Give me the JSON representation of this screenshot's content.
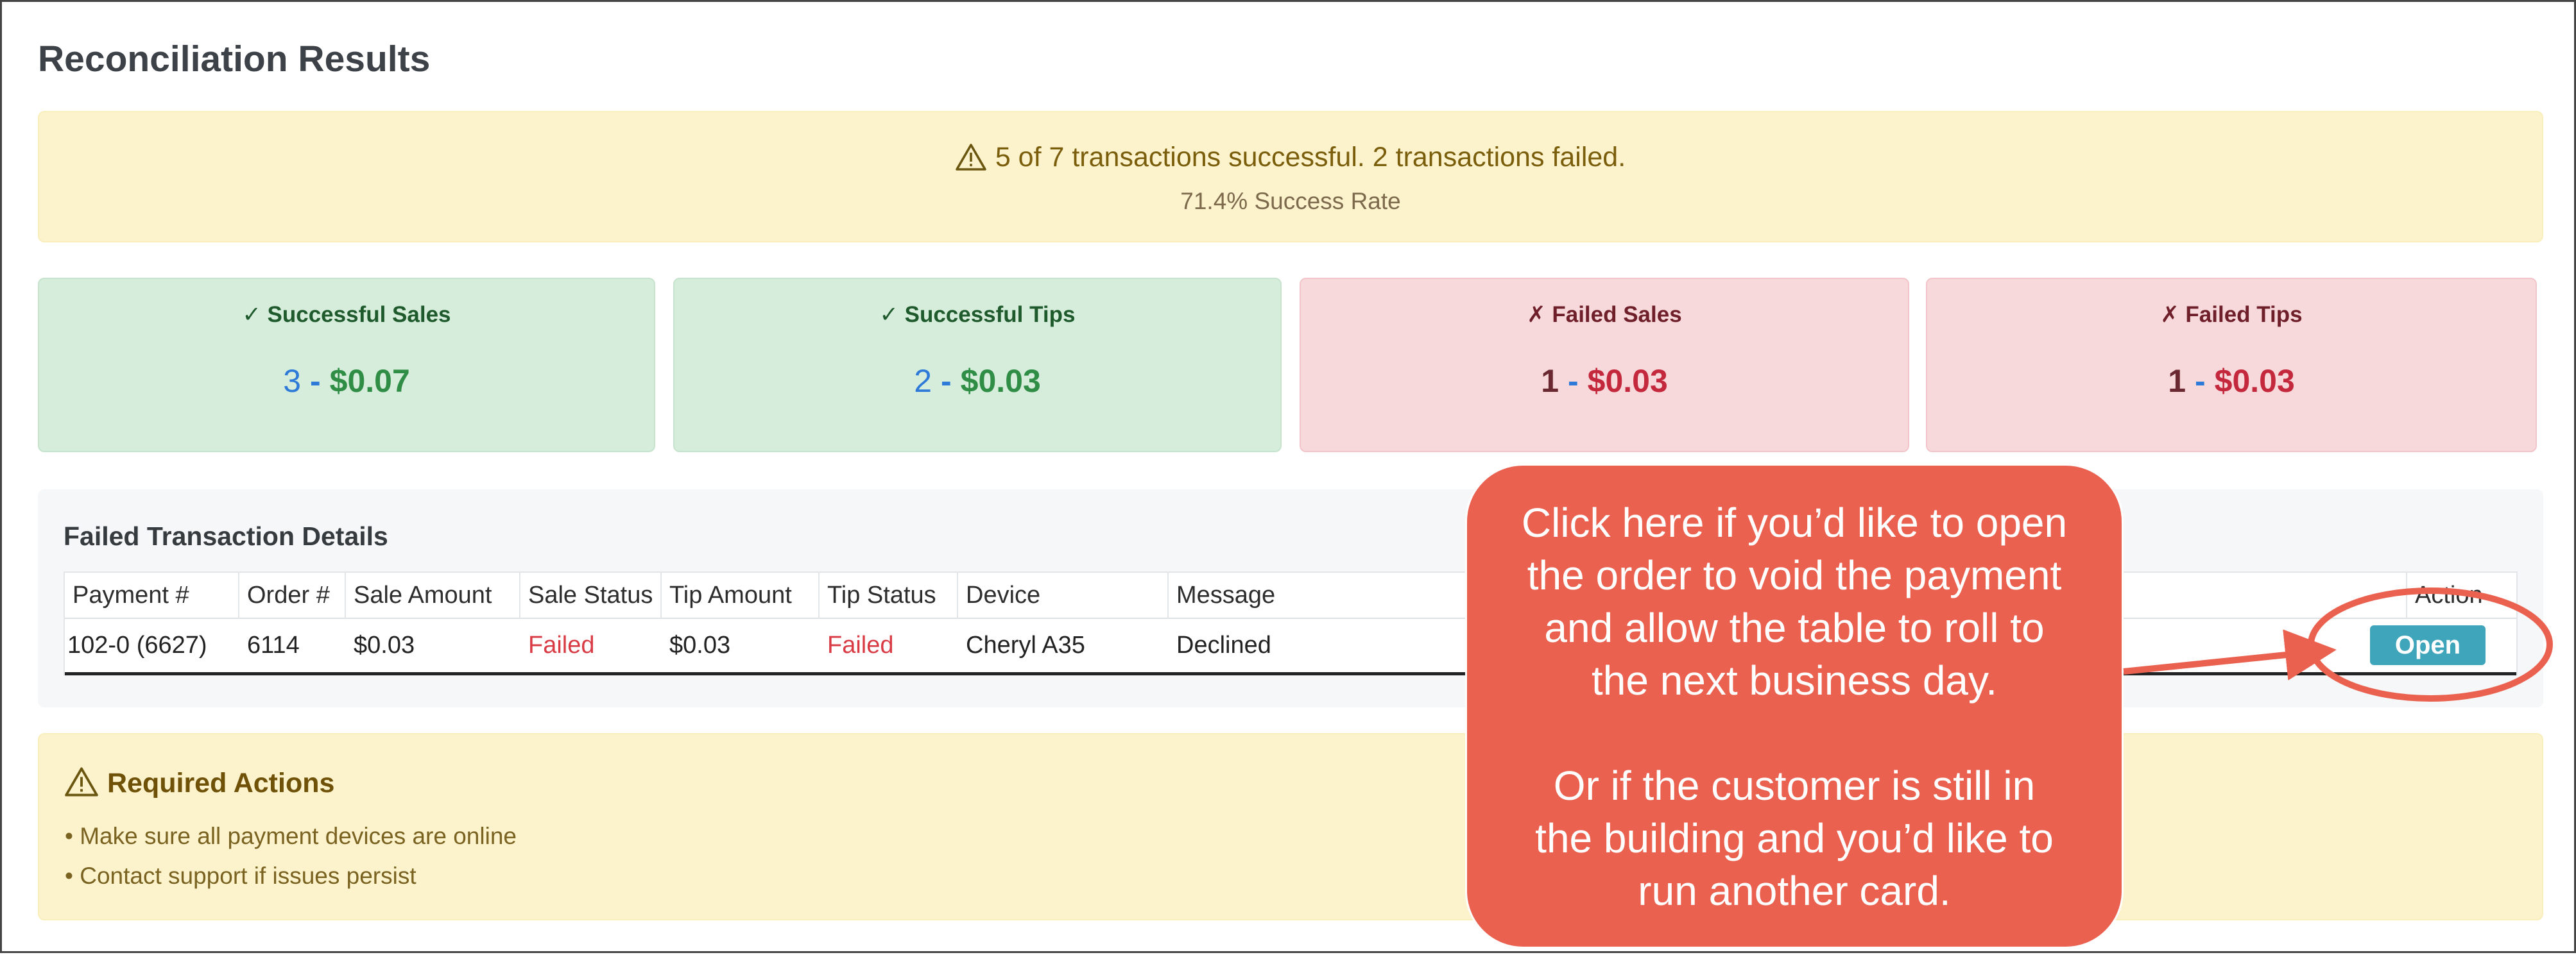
{
  "page": {
    "title": "Reconciliation Results"
  },
  "summary": {
    "headline": "5 of 7 transactions successful. 2 transactions failed.",
    "success_rate": "71.4% Success Rate"
  },
  "cards": [
    {
      "title": "✓ Successful Sales",
      "count": "3",
      "amount": "$0.07",
      "status": "success"
    },
    {
      "title": "✓ Successful Tips",
      "count": "2",
      "amount": "$0.03",
      "status": "success"
    },
    {
      "title": "✗ Failed Sales",
      "count": "1",
      "amount": "$0.03",
      "status": "fail"
    },
    {
      "title": "✗ Failed Tips",
      "count": "1",
      "amount": "$0.03",
      "status": "fail"
    }
  ],
  "card_separator": "-",
  "failed_details": {
    "title": "Failed Transaction Details",
    "columns": [
      "Payment #",
      "Order #",
      "Sale Amount",
      "Sale Status",
      "Tip Amount",
      "Tip Status",
      "Device",
      "Message",
      "Action"
    ],
    "rows": [
      {
        "payment": "102-0 (6627)",
        "order": "6114",
        "sale_amount": "$0.03",
        "sale_status": "Failed",
        "tip_amount": "$0.03",
        "tip_status": "Failed",
        "device": "Cheryl A35",
        "message": "Declined",
        "action_label": "Open"
      }
    ]
  },
  "required_actions": {
    "title": "Required Actions",
    "items": [
      "• Make sure all payment devices are online",
      "• Contact support if issues persist"
    ]
  },
  "callout": {
    "paragraph1": "Click here if you’d like to open\nthe order to void the payment\nand allow the table to roll to\nthe next business day.",
    "paragraph2": "Or if the customer is still in\nthe building and you’d like to\nrun another card."
  },
  "colors": {
    "callout": "#ea6150",
    "open_button": "#3fa5ba",
    "success_card": "#d6eddc",
    "fail_card": "#f7d9db",
    "warning_banner": "#fcf3cd"
  }
}
